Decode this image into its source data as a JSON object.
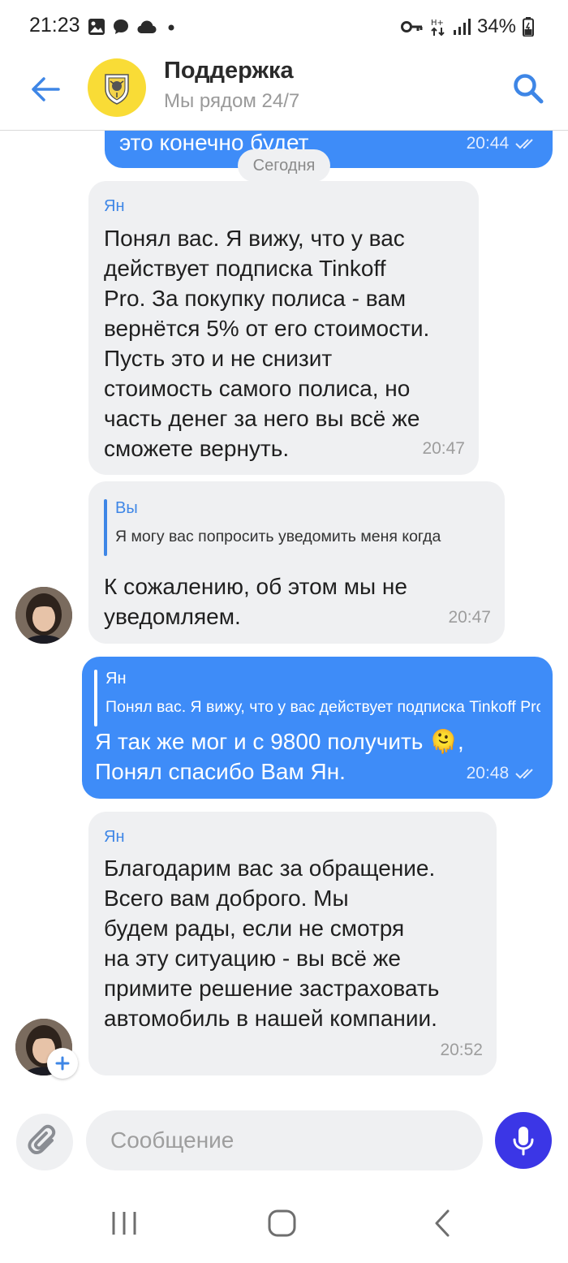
{
  "status_bar": {
    "time": "21:23",
    "battery": "34%"
  },
  "header": {
    "title": "Поддержка",
    "subtitle": "Мы рядом 24/7"
  },
  "messages": {
    "m0": {
      "text": "это конечно будет",
      "time": "20:44"
    },
    "date_label": "Сегодня",
    "m1": {
      "sender": "Ян",
      "lines": [
        "Понял вас. Я вижу, что у вас",
        "действует подписка Tinkoff",
        "Pro. За покупку полиса - вам",
        "вернётся 5% от его стоимости.",
        "Пусть это и не снизит",
        "стоимость самого полиса, но",
        "часть денег за него вы всё же",
        "сможете вернуть."
      ],
      "time": "20:47"
    },
    "m2": {
      "quote_name": "Вы",
      "quote_text": "Я могу вас попросить уведомить меня когда",
      "lines": [
        "К сожалению, об этом мы не",
        "уведомляем."
      ],
      "time": "20:47"
    },
    "m3": {
      "quote_name": "Ян",
      "quote_text": "Понял вас. Я вижу, что у вас действует подписка Tinkoff Pro",
      "lines": [
        "Я так же мог и с 9800 получить 🫠,",
        "Понял спасибо Вам Ян."
      ],
      "time": "20:48"
    },
    "m4": {
      "sender": "Ян",
      "lines": [
        "Благодарим вас за обращение.",
        "Всего вам доброго. Мы",
        "будем рады, если не смотря",
        "на эту ситуацию - вы всё же",
        "примите решение застраховать",
        "автомобиль в нашей компании."
      ],
      "time": "20:52"
    }
  },
  "input": {
    "placeholder": "Сообщение"
  },
  "colors": {
    "accent": "#3e8cf8",
    "incoming": "#eff0f2",
    "mic": "#3b36e6",
    "logo": "#f9dc36"
  }
}
